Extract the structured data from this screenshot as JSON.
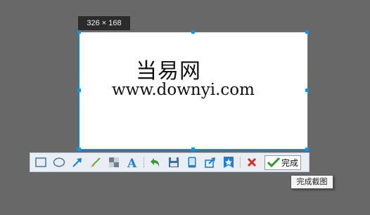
{
  "selection": {
    "size_label": "326 × 168"
  },
  "captured_content": {
    "title": "当易网",
    "url": "www.downyi.com"
  },
  "toolbar": {
    "tools": [
      {
        "name": "rectangle-tool",
        "icon": "rectangle-icon"
      },
      {
        "name": "ellipse-tool",
        "icon": "ellipse-icon"
      },
      {
        "name": "arrow-tool",
        "icon": "arrow-icon"
      },
      {
        "name": "brush-tool",
        "icon": "brush-icon"
      },
      {
        "name": "mosaic-tool",
        "icon": "mosaic-icon"
      },
      {
        "name": "text-tool",
        "icon": "text-icon"
      },
      {
        "name": "undo-tool",
        "icon": "undo-icon"
      },
      {
        "name": "save-tool",
        "icon": "save-icon"
      },
      {
        "name": "phone-tool",
        "icon": "phone-icon"
      },
      {
        "name": "share-tool",
        "icon": "share-icon"
      },
      {
        "name": "pin-tool",
        "icon": "pin-icon"
      },
      {
        "name": "cancel-tool",
        "icon": "close-icon"
      }
    ],
    "done_label": "完成"
  },
  "tooltip": {
    "text": "完成截图"
  },
  "colors": {
    "accent": "#1a8fe3",
    "confirm": "#2e9a2e",
    "cancel": "#d62b2b"
  }
}
